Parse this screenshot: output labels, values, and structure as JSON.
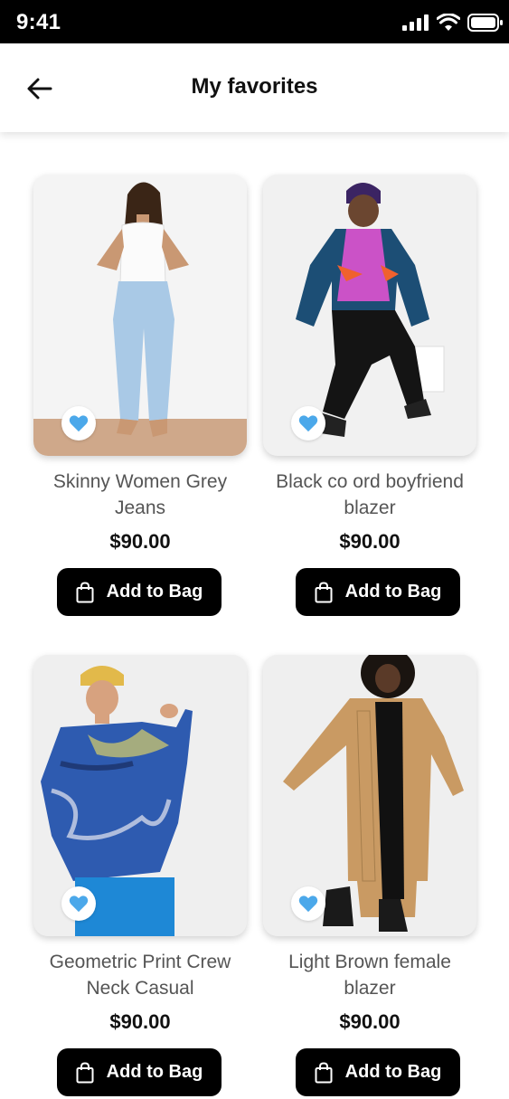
{
  "status_bar": {
    "time": "9:41"
  },
  "header": {
    "title": "My favorites"
  },
  "accent_color": "#4BA8EA",
  "products": [
    {
      "name": "Skinny Women Grey Jeans",
      "price": "$90.00",
      "button_label": "Add to Bag",
      "favorite": true
    },
    {
      "name": "Black co ord boyfriend blazer",
      "price": "$90.00",
      "button_label": "Add to Bag",
      "favorite": true
    },
    {
      "name": "Geometric Print Crew Neck Casual",
      "price": "$90.00",
      "button_label": "Add to Bag",
      "favorite": true
    },
    {
      "name": "Light Brown female blazer",
      "price": "$90.00",
      "button_label": "Add to Bag",
      "favorite": true
    }
  ],
  "icons": {
    "back": "arrow-left-icon",
    "favorite": "heart-icon",
    "bag": "shopping-bag-icon",
    "signal": "signal-icon",
    "wifi": "wifi-icon",
    "battery": "battery-icon"
  }
}
